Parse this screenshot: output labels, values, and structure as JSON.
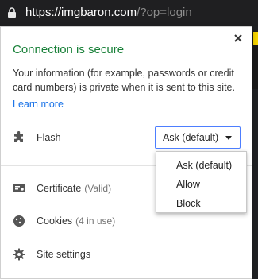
{
  "address_bar": {
    "url_host": "https://imgbaron.com",
    "url_path": "/?op=login",
    "icon": "lock-icon"
  },
  "popup": {
    "title": "Connection is secure",
    "description": "Your information (for example, passwords or credit card numbers) is private when it is sent to this site.",
    "learn_more": "Learn more",
    "close_icon": "close-icon",
    "flash": {
      "label": "Flash",
      "icon": "puzzle-icon",
      "selected": "Ask (default)",
      "options": [
        "Ask (default)",
        "Allow",
        "Block"
      ]
    },
    "certificate": {
      "label": "Certificate",
      "status": "(Valid)",
      "icon": "certificate-icon"
    },
    "cookies": {
      "label": "Cookies",
      "status": "(4 in use)",
      "icon": "cookie-icon"
    },
    "site_settings": {
      "label": "Site settings",
      "icon": "gear-icon"
    },
    "colors": {
      "secure_green": "#188038",
      "link_blue": "#1a73e8",
      "select_border": "#4d7eff"
    }
  }
}
